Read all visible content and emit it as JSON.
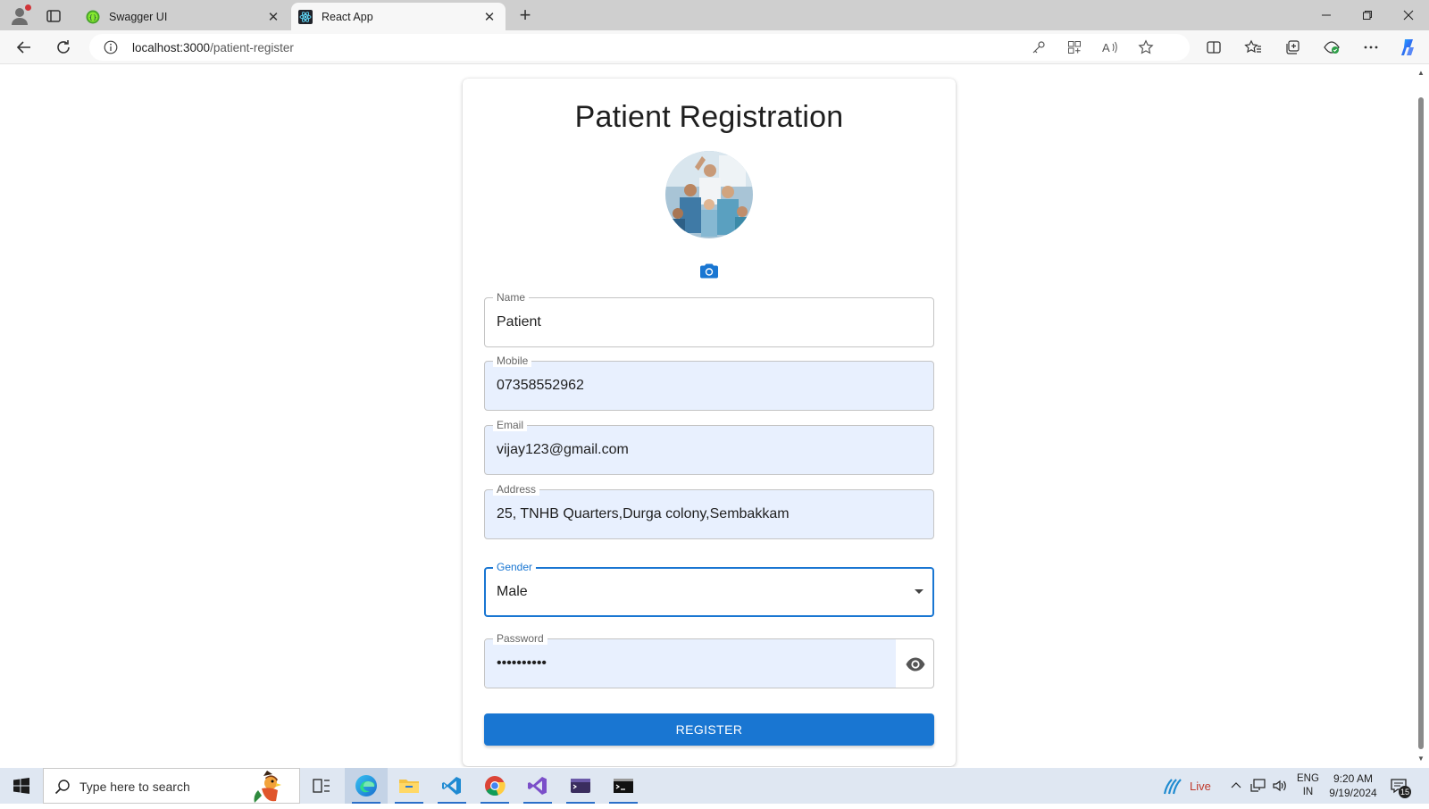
{
  "browser": {
    "tabs": [
      {
        "title": "Swagger UI",
        "active": false,
        "icon": "swagger-icon"
      },
      {
        "title": "React App",
        "active": true,
        "icon": "react-icon"
      }
    ],
    "address": {
      "host": "localhost:3000",
      "path": "/patient-register"
    }
  },
  "page": {
    "title": "Patient Registration",
    "fields": {
      "name": {
        "label": "Name",
        "value": "Patient"
      },
      "mobile": {
        "label": "Mobile",
        "value": "07358552962"
      },
      "email": {
        "label": "Email",
        "value": "vijay123@gmail.com"
      },
      "address": {
        "label": "Address",
        "value": "25, TNHB Quarters,Durga colony,Sembakkam"
      },
      "gender": {
        "label": "Gender",
        "value": "Male"
      },
      "password": {
        "label": "Password",
        "value": "••••••••••"
      }
    },
    "register_label": "REGISTER"
  },
  "taskbar": {
    "search_placeholder": "Type here to search",
    "weather": "Live",
    "lang_top": "ENG",
    "lang_bottom": "IN",
    "time": "9:20 AM",
    "date": "9/19/2024",
    "notification_count": "15"
  },
  "colors": {
    "primary": "#1976d2",
    "autofill_bg": "#e8f0fe",
    "taskbar_bg": "#dfe7f2"
  }
}
